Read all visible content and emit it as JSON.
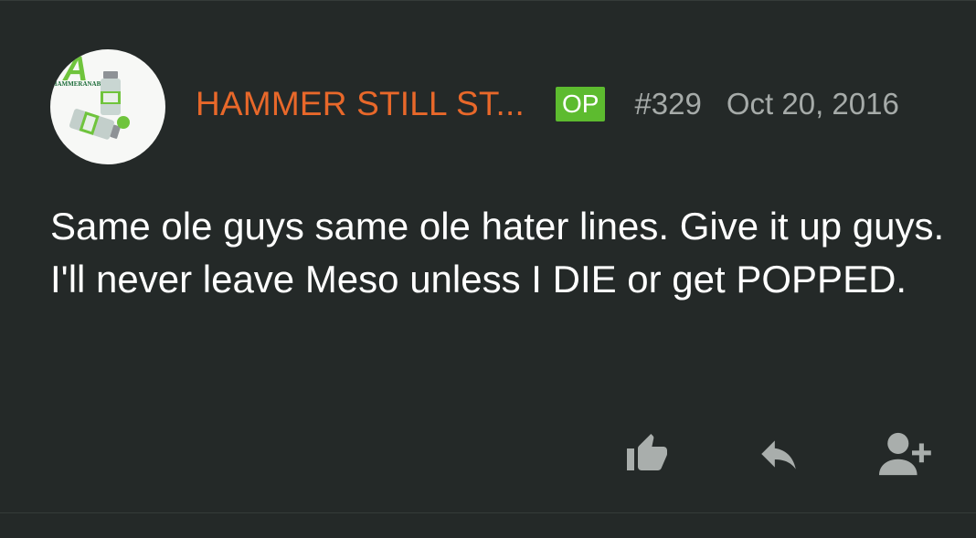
{
  "post": {
    "username": "HAMMER STILL ST...",
    "badge": "OP",
    "post_number": "#329",
    "date": "Oct 20, 2016",
    "message": "Same ole guys same ole hater lines. Give it up guys. I'll never leave Meso unless I DIE or get POPPED.",
    "avatar": {
      "logo_letter": "A",
      "logo_text": "HAMMERANABOLICS"
    }
  },
  "actions": {
    "like_icon": "thumbs-up-icon",
    "reply_icon": "reply-icon",
    "follow_icon": "add-user-icon"
  },
  "colors": {
    "background": "#242928",
    "username": "#e8682a",
    "op_badge": "#5dbb2f",
    "meta_text": "#a6aba9",
    "message_text": "#ffffff",
    "icon": "#a9aeac"
  }
}
